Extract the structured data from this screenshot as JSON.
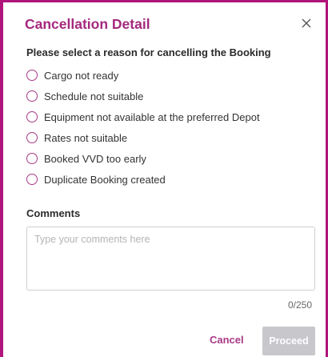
{
  "dialog": {
    "title": "Cancellation Detail",
    "close_icon": "close-icon",
    "prompt": "Please select a reason for cancelling the Booking",
    "reasons": [
      {
        "label": "Cargo not ready",
        "selected": false
      },
      {
        "label": "Schedule not suitable",
        "selected": false
      },
      {
        "label": "Equipment not available at the preferred Depot",
        "selected": false
      },
      {
        "label": "Rates not suitable",
        "selected": false
      },
      {
        "label": "Booked VVD too early",
        "selected": false
      },
      {
        "label": "Duplicate Booking created",
        "selected": false
      }
    ],
    "comments_label": "Comments",
    "comments_placeholder": "Type your comments here",
    "comments_value": "",
    "counter": "0/250",
    "cancel_label": "Cancel",
    "proceed_label": "Proceed",
    "proceed_disabled": true
  },
  "colors": {
    "accent": "#a4287e",
    "border": "#b0157c",
    "disabled_button": "#c7c7cc"
  }
}
